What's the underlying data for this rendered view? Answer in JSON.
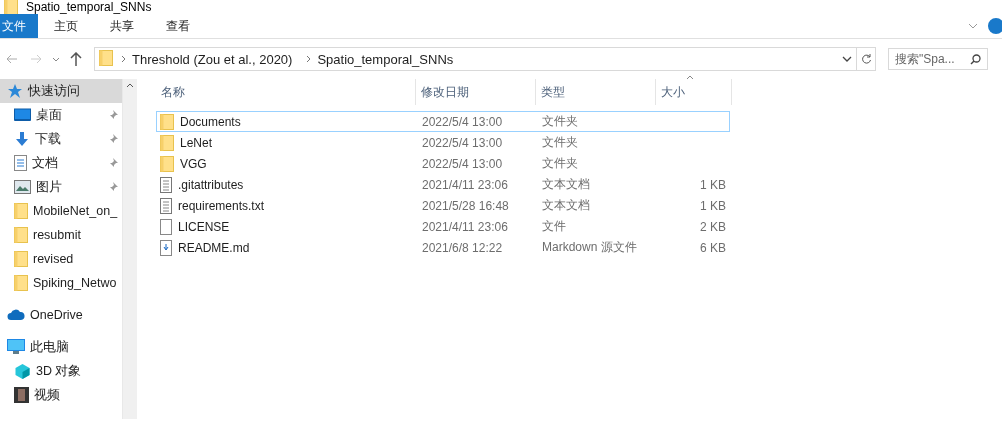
{
  "window": {
    "title": "Spatio_temporal_SNNs"
  },
  "ribbon_tabs": [
    {
      "label": "文件",
      "selected": true
    },
    {
      "label": "主页",
      "selected": false
    },
    {
      "label": "共享",
      "selected": false
    },
    {
      "label": "查看",
      "selected": false
    }
  ],
  "address_bar": {
    "path": [
      "Threshold (Zou et al., 2020)",
      "Spatio_temporal_SNNs"
    ]
  },
  "search": {
    "placeholder": "搜索\"Spa..."
  },
  "sidebar": {
    "items": [
      {
        "label": "快速访问",
        "kind": "quick",
        "selected": true,
        "pinned": false,
        "children": [
          {
            "label": "桌面",
            "kind": "desktop",
            "selected": false,
            "pinned": true
          },
          {
            "label": "下载",
            "kind": "download",
            "selected": false,
            "pinned": true
          },
          {
            "label": "文档",
            "kind": "document",
            "selected": false,
            "pinned": true
          },
          {
            "label": "图片",
            "kind": "pictures",
            "selected": false,
            "pinned": true
          },
          {
            "label": "MobileNet_on_",
            "kind": "folder",
            "selected": false,
            "pinned": false
          },
          {
            "label": "resubmit",
            "kind": "folder",
            "selected": false,
            "pinned": false
          },
          {
            "label": "revised",
            "kind": "folder",
            "selected": false,
            "pinned": false
          },
          {
            "label": "Spiking_Netwo",
            "kind": "folder",
            "selected": false,
            "pinned": false
          }
        ]
      },
      {
        "label": "OneDrive",
        "kind": "cloud",
        "selected": false,
        "pinned": false
      },
      {
        "label": "此电脑",
        "kind": "pc",
        "selected": false,
        "pinned": false,
        "children": [
          {
            "label": "3D 对象",
            "kind": "cube",
            "selected": false,
            "pinned": false
          },
          {
            "label": "视频",
            "kind": "video",
            "selected": false,
            "pinned": false
          }
        ]
      }
    ]
  },
  "table": {
    "columns": [
      "名称",
      "修改日期",
      "类型",
      "大小"
    ],
    "rows": [
      {
        "kind": "folder",
        "focused": true,
        "cells": [
          "Documents",
          "2022/5/4 13:00",
          "文件夹",
          ""
        ]
      },
      {
        "kind": "folder",
        "focused": false,
        "cells": [
          "LeNet",
          "2022/5/4 13:00",
          "文件夹",
          ""
        ]
      },
      {
        "kind": "folder",
        "focused": false,
        "cells": [
          "VGG",
          "2022/5/4 13:00",
          "文件夹",
          ""
        ]
      },
      {
        "kind": "text",
        "focused": false,
        "cells": [
          ".gitattributes",
          "2021/4/11 23:06",
          "文本文档",
          "1 KB"
        ]
      },
      {
        "kind": "text",
        "focused": false,
        "cells": [
          "requirements.txt",
          "2021/5/28 16:48",
          "文本文档",
          "1 KB"
        ]
      },
      {
        "kind": "file",
        "focused": false,
        "cells": [
          "LICENSE",
          "2021/4/11 23:06",
          "文件",
          "2 KB"
        ]
      },
      {
        "kind": "markdown",
        "focused": false,
        "cells": [
          "README.md",
          "2021/6/8 12:22",
          "Markdown 源文件",
          "6 KB"
        ]
      }
    ]
  }
}
